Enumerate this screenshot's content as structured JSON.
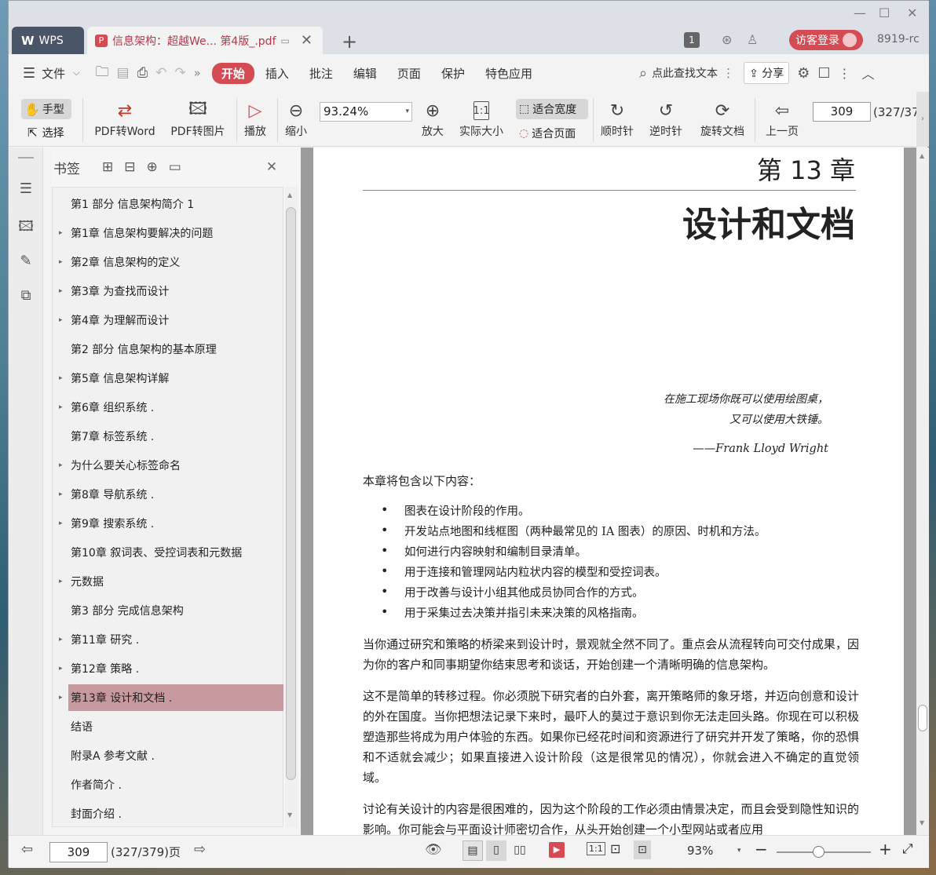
{
  "titlebar": {
    "wps_tab": "WPS",
    "doc_tab": "信息架构：超越We... 第4版_.pdf",
    "page_badge": "1",
    "login": "访客登录",
    "user_code": "8919-rc"
  },
  "menu": {
    "file": "文件",
    "start": "开始",
    "insert": "插入",
    "annotate": "批注",
    "edit": "编辑",
    "page": "页面",
    "protect": "保护",
    "special": "特色应用",
    "search": "点此查找文本",
    "share": "分享"
  },
  "ribbon": {
    "hand": "手型",
    "select": "选择",
    "pdf2word": "PDF转Word",
    "pdf2img": "PDF转图片",
    "play": "播放",
    "zoom_out": "缩小",
    "zoom_value": "93.24%",
    "zoom_in": "放大",
    "actual": "实际大小",
    "fit_width": "适合宽度",
    "fit_page": "适合页面",
    "cw": "顺时针",
    "ccw": "逆时针",
    "rotate": "旋转文档",
    "prev": "上一页",
    "page_num": "309",
    "page_total": "(327/37"
  },
  "bookmarks": {
    "title": "书签",
    "items": [
      {
        "label": "第1 部分 信息架构简介  1",
        "arrow": false
      },
      {
        "label": "第1章 信息架构要解决的问题",
        "arrow": true
      },
      {
        "label": "第2章 信息架构的定义",
        "arrow": true
      },
      {
        "label": "第3章 为查找而设计",
        "arrow": true
      },
      {
        "label": "第4章 为理解而设计",
        "arrow": true
      },
      {
        "label": "第2 部分 信息架构的基本原理",
        "arrow": false
      },
      {
        "label": "第5章 信息架构详解",
        "arrow": true
      },
      {
        "label": "第6章 组织系统 .",
        "arrow": true
      },
      {
        "label": "第7章 标签系统 .",
        "arrow": false
      },
      {
        "label": "为什么要关心标签命名",
        "arrow": true
      },
      {
        "label": "第8章 导航系统 .",
        "arrow": true
      },
      {
        "label": "第9章 搜索系统 .",
        "arrow": true
      },
      {
        "label": "第10章 叙词表、受控词表和元数据",
        "arrow": false
      },
      {
        "label": "元数据",
        "arrow": true
      },
      {
        "label": "第3 部分 完成信息架构",
        "arrow": false
      },
      {
        "label": "第11章 研究 .",
        "arrow": true
      },
      {
        "label": "第12章 策略 .",
        "arrow": true
      },
      {
        "label": "第13章 设计和文档 .",
        "arrow": true,
        "selected": true
      },
      {
        "label": "结语",
        "arrow": false
      },
      {
        "label": "附录A 参考文献 .",
        "arrow": false
      },
      {
        "label": "作者简介 .",
        "arrow": false
      },
      {
        "label": "封面介绍 .",
        "arrow": false
      }
    ]
  },
  "doc": {
    "chapter": "第 13 章",
    "title": "设计和文档",
    "quote1": "在施工现场你既可以使用绘图桌，",
    "quote2": "又可以使用大铁锤。",
    "quote_author": "——Frank Lloyd Wright",
    "intro": "本章将包含以下内容：",
    "bullets": [
      "图表在设计阶段的作用。",
      "开发站点地图和线框图（两种最常见的 IA 图表）的原因、时机和方法。",
      "如何进行内容映射和编制目录清单。",
      "用于连接和管理网站内粒状内容的模型和受控词表。",
      "用于改善与设计小组其他成员协同合作的方式。",
      "用于采集过去决策并指引未来决策的风格指南。"
    ],
    "p1": "当你通过研究和策略的桥梁来到设计时，景观就全然不同了。重点会从流程转向可交付成果，因为你的客户和同事期望你结束思考和谈话，开始创建一个清晰明确的信息架构。",
    "p2": "这不是简单的转移过程。你必须脱下研究者的白外套，离开策略师的象牙塔，并迈向创意和设计的外在国度。当你把想法记录下来时，最吓人的莫过于意识到你无法走回头路。你现在可以积极塑造那些将成为用户体验的东西。如果你已经花时间和资源进行了研究并开发了策略，你的恐惧和不适就会减少；如果直接进入设计阶段（这是很常见的情况），你就会进入不确定的直觉领域。",
    "p3": "讨论有关设计的内容是很困难的，因为这个阶段的工作必须由情景决定，而且会受到隐性知识的影响。你可能会与平面设计师密切合作，从头开始创建一个小型网站或者应用"
  },
  "status": {
    "page_num": "309",
    "page_info": "(327/379)页",
    "zoom": "93%"
  }
}
